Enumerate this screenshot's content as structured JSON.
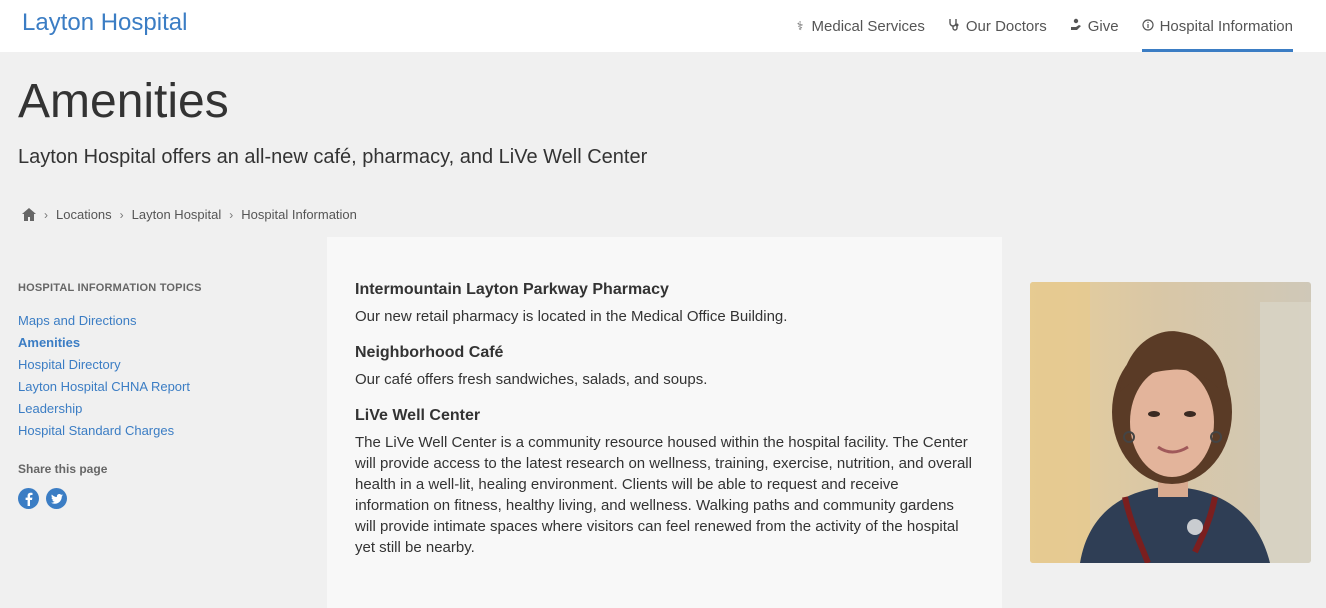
{
  "header": {
    "brand": "Layton Hospital",
    "nav": [
      {
        "label": "Medical Services",
        "icon": "caduceus-icon"
      },
      {
        "label": "Our Doctors",
        "icon": "stethoscope-icon"
      },
      {
        "label": "Give",
        "icon": "giving-hand-icon"
      },
      {
        "label": "Hospital Information",
        "icon": "info-circle-icon",
        "active": true
      }
    ]
  },
  "page": {
    "title": "Amenities",
    "subtitle": "Layton Hospital offers an all-new café, pharmacy, and LiVe Well Center"
  },
  "breadcrumb": {
    "items": [
      "Locations",
      "Layton Hospital",
      "Hospital Information"
    ]
  },
  "sidebar": {
    "heading": "HOSPITAL INFORMATION TOPICS",
    "links": [
      {
        "label": "Maps and Directions"
      },
      {
        "label": "Amenities",
        "active": true
      },
      {
        "label": "Hospital Directory"
      },
      {
        "label": "Layton Hospital CHNA Report"
      },
      {
        "label": "Leadership"
      },
      {
        "label": "Hospital Standard Charges"
      }
    ],
    "share_label": "Share this page",
    "social": [
      "facebook-icon",
      "twitter-icon"
    ]
  },
  "sections": [
    {
      "title": "Intermountain Layton Parkway Pharmacy",
      "body": "Our new retail pharmacy is located in the Medical Office Building."
    },
    {
      "title": "Neighborhood Café",
      "body": "Our café offers fresh sandwiches, salads, and soups."
    },
    {
      "title": "LiVe Well Center",
      "body": "The LiVe Well Center is a community resource housed within the hospital facility. The Center will provide access to the latest research on wellness, training, exercise, nutrition, and overall health in a well-lit, healing environment. Clients will be able to request and receive information on fitness, healthy living, and wellness. Walking paths and community gardens will provide intimate spaces where visitors can feel renewed from the activity of the hospital yet still be nearby."
    }
  ],
  "colors": {
    "accent": "#3b7dc4",
    "page_bg": "#f0f0f0",
    "content_bg": "#f8f8f8"
  }
}
